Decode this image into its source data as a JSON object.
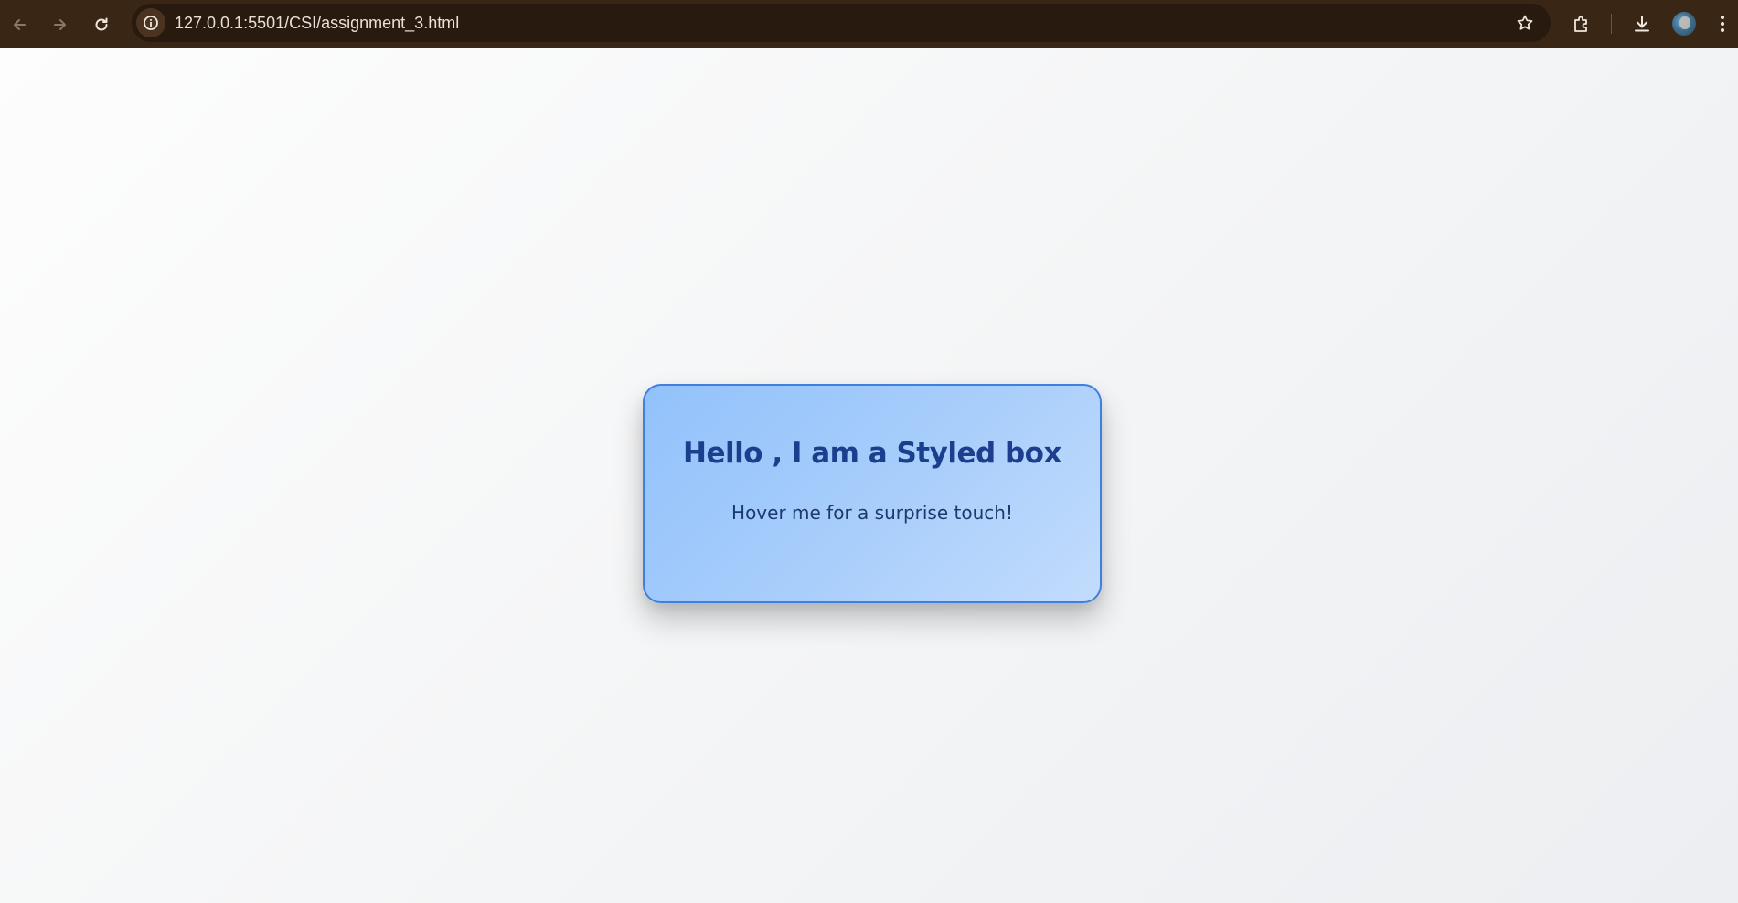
{
  "browser": {
    "url": "127.0.0.1:5501/CSI/assignment_3.html",
    "icons": {
      "back": "back-arrow-icon",
      "forward": "forward-arrow-icon",
      "reload": "reload-icon",
      "site_info": "info-icon",
      "bookmark": "star-icon",
      "extensions": "puzzle-icon",
      "downloads": "download-icon",
      "profile": "avatar",
      "menu": "kebab-menu-icon"
    },
    "colors": {
      "toolbar": "#3a2614",
      "omnibox": "#281a0e"
    }
  },
  "page": {
    "box": {
      "title": "Hello , I am a Styled box",
      "text": "Hover me for a surprise touch!"
    },
    "colors": {
      "box_border": "#3f7fdf",
      "box_bg_start": "#92c2fb",
      "box_bg_end": "#c2dcfc",
      "title": "#1b3f8c",
      "text": "#1d3a6e"
    }
  }
}
